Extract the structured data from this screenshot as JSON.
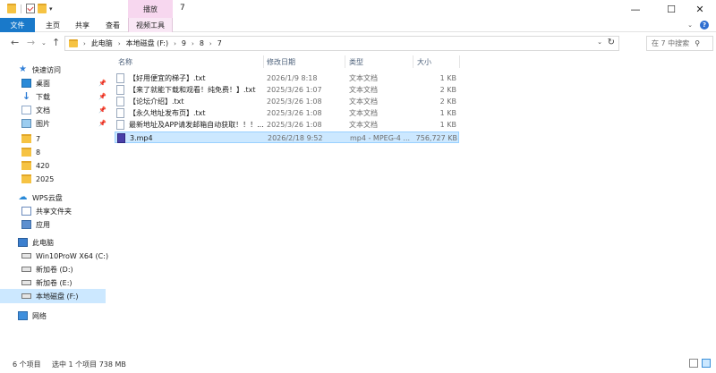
{
  "window": {
    "title": "7",
    "context_tab": "播放",
    "controls": {
      "minimize": "—",
      "maximize": "☐",
      "close": "✕"
    }
  },
  "ribbon": {
    "tabs": [
      "文件",
      "主页",
      "共享",
      "查看",
      "视频工具"
    ]
  },
  "address": {
    "crumbs": [
      "此电脑",
      "本地磁盘 (F:)",
      "9",
      "8",
      "7"
    ],
    "search_placeholder": "在 7 中搜索"
  },
  "nav": {
    "quick_access": "快速访问",
    "pinned": [
      {
        "label": "桌面",
        "icon": "desktop-icon"
      },
      {
        "label": "下载",
        "icon": "download-icon"
      },
      {
        "label": "文档",
        "icon": "document-icon"
      },
      {
        "label": "图片",
        "icon": "picture-icon"
      }
    ],
    "recent_folders": [
      "7",
      "8",
      "420",
      "2025"
    ],
    "wps_cloud": "WPS云盘",
    "wps_items": [
      "共享文件夹",
      "应用"
    ],
    "this_pc": "此电脑",
    "drives": [
      "Win10ProW X64 (C:)",
      "新加卷 (D:)",
      "新加卷 (E:)",
      "本地磁盘 (F:)"
    ],
    "network": "网络"
  },
  "list": {
    "columns": [
      "名称",
      "修改日期",
      "类型",
      "大小"
    ],
    "files": [
      {
        "name": "【好用便宜的梯子】.txt",
        "date": "2026/1/9 8:18",
        "type": "文本文档",
        "size": "1 KB"
      },
      {
        "name": "【来了就能下载和观看！纯免费！】.txt",
        "date": "2025/3/26 1:07",
        "type": "文本文档",
        "size": "2 KB"
      },
      {
        "name": "【论坛介绍】.txt",
        "date": "2025/3/26 1:08",
        "type": "文本文档",
        "size": "2 KB"
      },
      {
        "name": "【永久地址发布页】.txt",
        "date": "2025/3/26 1:08",
        "type": "文本文档",
        "size": "1 KB"
      },
      {
        "name": "最新地址及APP请发邮箱自动获取！！！...",
        "date": "2025/3/26 1:08",
        "type": "文本文档",
        "size": "1 KB"
      },
      {
        "name": "3.mp4",
        "date": "2026/2/18 9:52",
        "type": "mp4 - MPEG-4 ...",
        "size": "756,727 KB"
      }
    ]
  },
  "status": {
    "count": "6 个项目",
    "selected": "选中 1 个项目  738 MB"
  }
}
